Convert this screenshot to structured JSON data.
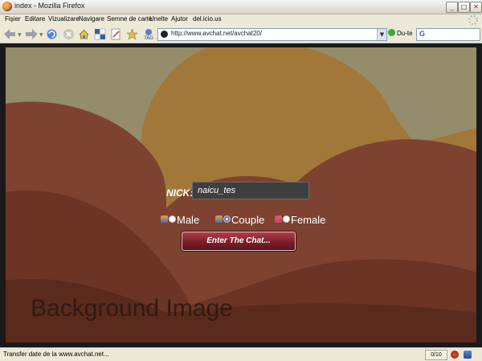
{
  "window": {
    "title": "index - Mozilla Firefox",
    "minimize": "_",
    "maximize": "□",
    "close": "✕"
  },
  "menu": [
    "Fişier",
    "Editare",
    "Vizualizare",
    "Navigare",
    "Semne de carte",
    "Unelte",
    "Ajutor",
    "del.icio.us"
  ],
  "toolbar": {
    "url": "http://www.avchat.net/avchat20/",
    "go_label": "Du-te",
    "search_engine": "G"
  },
  "page": {
    "nick_label": "NICK:",
    "nick_value": "naicu_tes",
    "genders": [
      {
        "label": "Male",
        "icon": "male-user-icon",
        "selected": false
      },
      {
        "label": "Couple",
        "icon": "couple-user-icon",
        "selected": true
      },
      {
        "label": "Female",
        "icon": "female-user-icon",
        "selected": false
      }
    ],
    "enter_button": "Enter The Chat...",
    "background_caption": "Background Image"
  },
  "status": {
    "text": "Transfer date de la www.avchat.net...",
    "counter": "0/10"
  },
  "colors": {
    "accent_button": "#7a1f2a",
    "sky": "#948c6a",
    "hill_gold": "#a2783a",
    "hill_rust": "#7e4231"
  }
}
